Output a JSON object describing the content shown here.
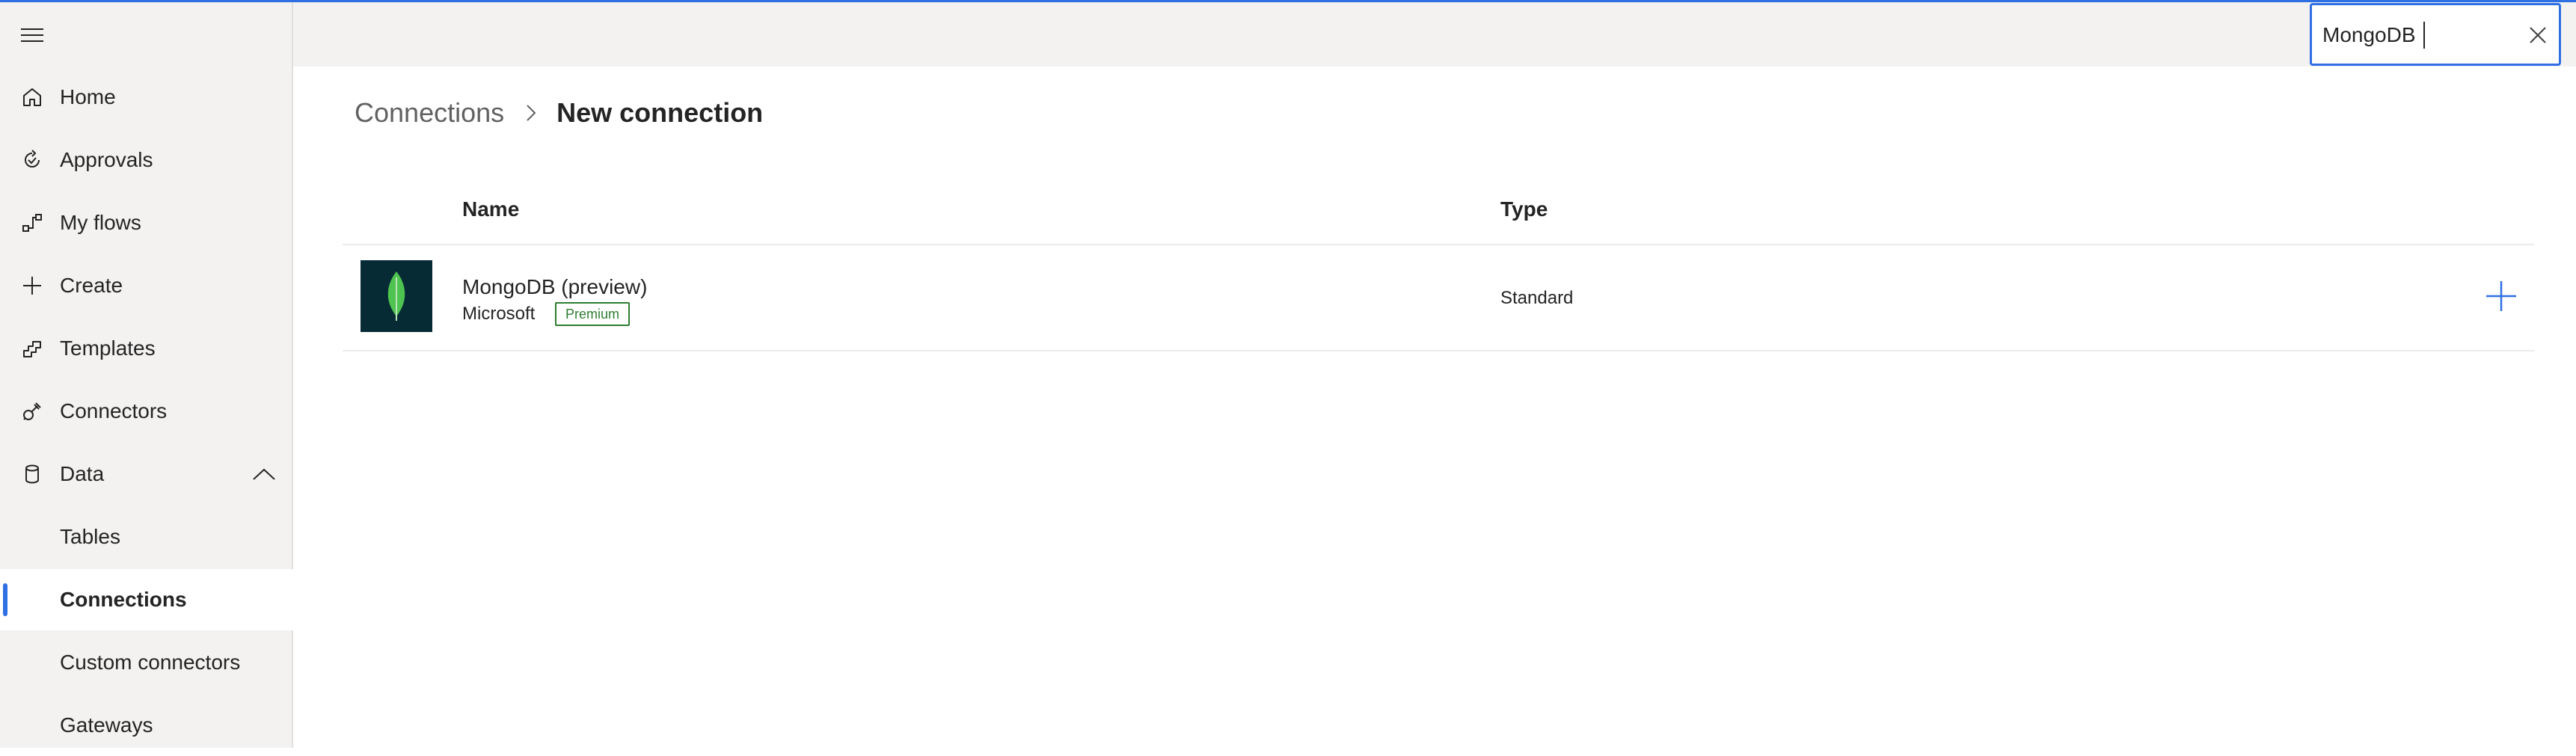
{
  "colors": {
    "accent": "#2f6fe4",
    "sidebar_bg": "#f3f2f1",
    "premium": "#2e7d32",
    "logo_bg": "#062b35",
    "logo_leaf": "#4fc34f"
  },
  "sidebar": {
    "menu_icon": "hamburger-icon",
    "items": [
      {
        "label": "Home",
        "icon": "home-icon"
      },
      {
        "label": "Approvals",
        "icon": "approvals-icon"
      },
      {
        "label": "My flows",
        "icon": "flows-icon"
      },
      {
        "label": "Create",
        "icon": "plus-icon"
      },
      {
        "label": "Templates",
        "icon": "templates-icon"
      },
      {
        "label": "Connectors",
        "icon": "connector-plug-icon"
      },
      {
        "label": "Data",
        "icon": "database-icon",
        "expanded": true
      },
      {
        "label": "Tables"
      },
      {
        "label": "Connections",
        "selected": true
      },
      {
        "label": "Custom connectors"
      },
      {
        "label": "Gateways"
      }
    ]
  },
  "search": {
    "value": "MongoDB",
    "clear_icon": "close-icon"
  },
  "breadcrumb": {
    "parent": "Connections",
    "current": "New connection"
  },
  "table": {
    "columns": {
      "name": "Name",
      "type": "Type"
    },
    "rows": [
      {
        "name": "MongoDB (preview)",
        "publisher": "Microsoft",
        "badge": "Premium",
        "type": "Standard",
        "logo_icon": "mongodb-leaf-icon",
        "action_icon": "add-icon"
      }
    ]
  }
}
